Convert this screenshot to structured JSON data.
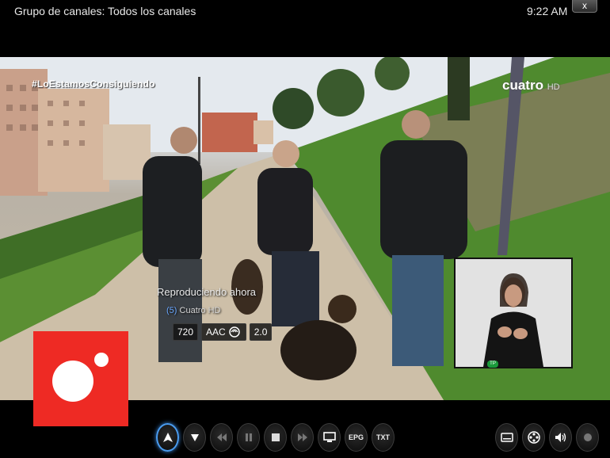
{
  "header": {
    "group_title": "Grupo de canales: Todos los canales",
    "clock": "9:22 AM",
    "close_symbol": "x"
  },
  "video": {
    "hashtag": "#LoEstamosConsiguiendo",
    "channel_logo": "cuatro",
    "channel_logo_suffix": "HD",
    "sign_badge": "TP"
  },
  "now_playing": {
    "label": "Reproduciendo ahora",
    "channel_number": "(5)",
    "channel_name": "Cuatro HD",
    "flags": {
      "resolution": "720",
      "audio_codec": "AAC",
      "audio_channels": "2.0"
    }
  },
  "controls": {
    "left": [
      {
        "name": "up-arrow-button",
        "icon": "up-arrow-icon",
        "glyph": "▲",
        "active": true
      },
      {
        "name": "down-arrow-button",
        "icon": "down-arrow-icon",
        "glyph": "▼"
      },
      {
        "name": "rewind-button",
        "icon": "rewind-icon",
        "glyph": "◀◀",
        "dim": true
      },
      {
        "name": "pause-button",
        "icon": "pause-icon",
        "glyph": "❚❚",
        "dim": true
      },
      {
        "name": "stop-button",
        "icon": "stop-icon",
        "glyph": "■"
      },
      {
        "name": "fast-forward-button",
        "icon": "fast-forward-icon",
        "glyph": "▶▶",
        "dim": true
      },
      {
        "name": "tv-button",
        "icon": "tv-icon",
        "glyph": "tv"
      },
      {
        "name": "epg-button",
        "icon": "epg-icon",
        "text": "EPG"
      },
      {
        "name": "teletext-button",
        "icon": "teletext-icon",
        "text": "TXT"
      }
    ],
    "right": [
      {
        "name": "subtitles-button",
        "icon": "subtitles-icon",
        "glyph": "sub"
      },
      {
        "name": "video-settings-button",
        "icon": "film-reel-icon",
        "glyph": "reel"
      },
      {
        "name": "volume-button",
        "icon": "volume-icon",
        "glyph": "vol"
      },
      {
        "name": "record-button",
        "icon": "record-icon",
        "glyph": "rec",
        "dim": true
      }
    ]
  },
  "colors": {
    "accent_blue": "#4a9cf0",
    "logo_red": "#ee2a24",
    "badge_green": "#1a9a3a"
  }
}
